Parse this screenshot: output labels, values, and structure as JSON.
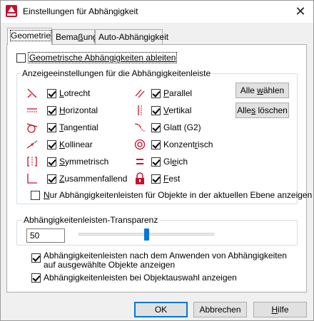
{
  "window": {
    "title": "Einstellungen für Abhängigkeit"
  },
  "tabs": [
    {
      "label": "Geometrie",
      "active": true
    },
    {
      "label_pre": "Bema",
      "label_u": "ß",
      "label_post": "ung",
      "active": false
    },
    {
      "label": "Auto-Abhängigkeit",
      "active": false
    }
  ],
  "infer": {
    "label": "Geometrische Abhängigkeiten ableiten",
    "checked": false
  },
  "bar_group": {
    "title": "Anzeigeeinstellungen für die Abhängigkeitenleiste",
    "left": [
      {
        "icon": "perpendicular-icon",
        "u": "L",
        "rest": "otrecht",
        "checked": true
      },
      {
        "icon": "horizontal-icon",
        "u": "H",
        "rest": "orizontal",
        "checked": true
      },
      {
        "icon": "tangent-icon",
        "u": "T",
        "rest": "angential",
        "checked": true
      },
      {
        "icon": "collinear-icon",
        "u": "K",
        "rest": "ollinear",
        "checked": true
      },
      {
        "icon": "symmetric-icon",
        "u": "S",
        "rest": "ymmetrisch",
        "checked": true
      },
      {
        "icon": "coincident-icon",
        "u": "Z",
        "rest": "usammenfallend",
        "checked": true
      }
    ],
    "right": [
      {
        "icon": "parallel-icon",
        "u": "P",
        "rest": "arallel",
        "checked": true
      },
      {
        "icon": "vertical-icon",
        "u": "V",
        "rest": "ertikal",
        "checked": true
      },
      {
        "icon": "smooth-icon",
        "u": "",
        "rest": "Glatt (G2)",
        "checked": true
      },
      {
        "icon": "concentric-icon",
        "pre": "Konzent",
        "u": "r",
        "rest": "isch",
        "checked": true
      },
      {
        "icon": "equal-icon",
        "pre": "Gl",
        "u": "e",
        "rest": "ich",
        "checked": true
      },
      {
        "icon": "fix-icon",
        "u": "F",
        "rest": "est",
        "checked": true
      }
    ],
    "select_all": {
      "pre": "Alle ",
      "u": "w",
      "post": "ählen"
    },
    "clear_all": {
      "pre": "Alle",
      "u": "s",
      "post": " löschen"
    },
    "only_current_layer": {
      "u": "N",
      "rest": "ur Abhängigkeitenleisten für Objekte in der aktuellen Ebene anzeigen",
      "checked": false
    }
  },
  "transparency": {
    "title": "Abhängigkeitenleisten-Transparenz",
    "value": "50",
    "slider_fraction": 0.5
  },
  "show_after_apply": {
    "line1": "Abhängigkeitenleisten nach dem Anwenden von Abhängigkeiten",
    "line2": "auf ausgewählte Objekte anzeigen",
    "checked": true
  },
  "show_on_select": {
    "label": "Abhängigkeitenleisten bei Objektauswahl anzeigen",
    "checked": true
  },
  "buttons": {
    "ok": "OK",
    "cancel": "Abbrechen",
    "help_u": "H",
    "help_rest": "ilfe"
  },
  "colors": {
    "accent": "#0078d7",
    "icon_red": "#c8102e"
  }
}
